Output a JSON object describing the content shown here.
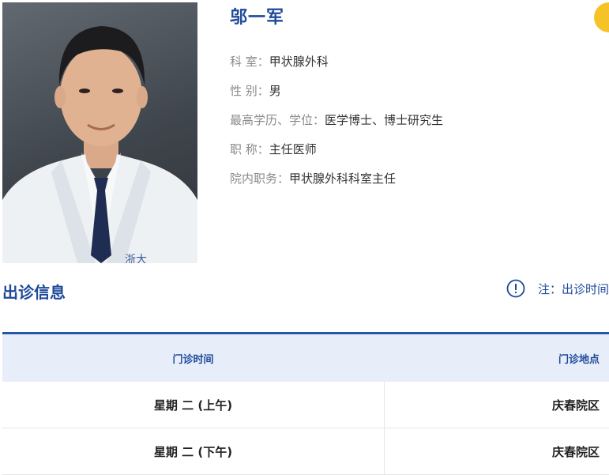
{
  "doctor": {
    "name": "邬一军",
    "photo_alt": "医生照片"
  },
  "info": [
    {
      "label": "科 室：",
      "value": "甲状腺外科"
    },
    {
      "label": "性 别：",
      "value": "男"
    },
    {
      "label": "最高学历、学位：",
      "value": "医学博士、博士研究生"
    },
    {
      "label": "职 称：",
      "value": "主任医师"
    },
    {
      "label": "院内职务：",
      "value": "甲状腺外科科室主任"
    }
  ],
  "schedule": {
    "title": "出诊信息",
    "note": "注：出诊时间",
    "columns": [
      "门诊时间",
      "门诊地点"
    ],
    "rows": [
      {
        "time": "星期 二 (上午)",
        "place": "庆春院区"
      },
      {
        "time": "星期 二 (下午)",
        "place": "庆春院区"
      }
    ]
  },
  "colors": {
    "accent": "#1e4a9a",
    "table_border": "#2557a7",
    "header_bg": "#e7eef9",
    "badge": "#f5c228"
  },
  "icons": {
    "note": "exclamation-circle-icon"
  }
}
